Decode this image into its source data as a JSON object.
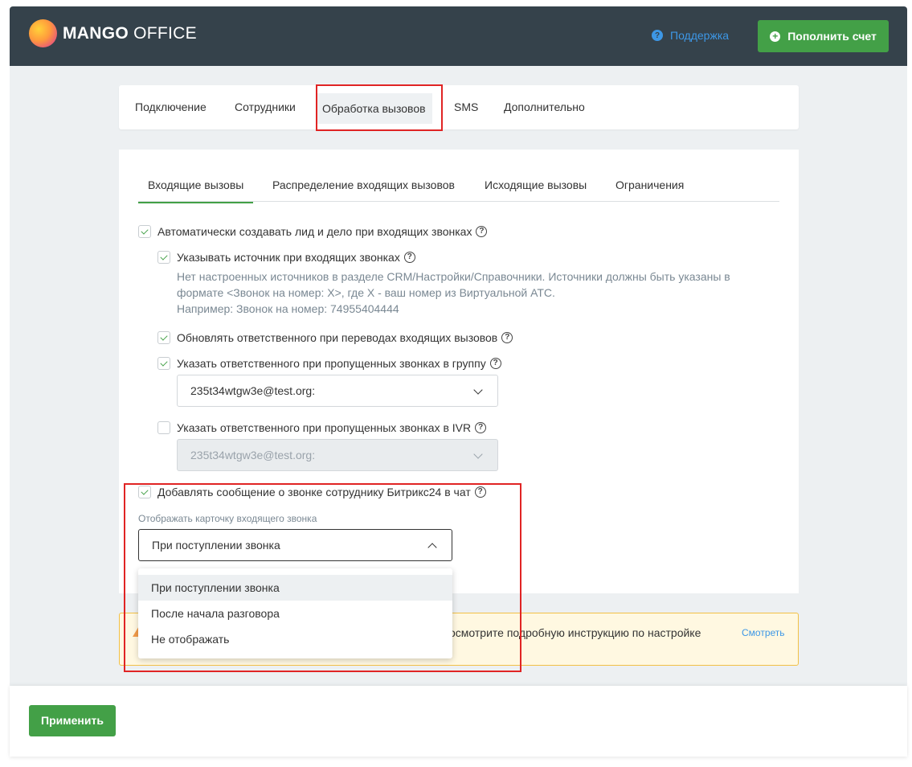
{
  "header": {
    "logo_bold": "MANGO",
    "logo_light": " OFFICE",
    "support_label": "Поддержка",
    "topup_label": "Пополнить счет"
  },
  "main_tabs": [
    {
      "label": "Подключение"
    },
    {
      "label": "Сотрудники"
    },
    {
      "label": "Обработка вызовов"
    },
    {
      "label": "SMS"
    },
    {
      "label": "Дополнительно"
    }
  ],
  "sub_tabs": [
    {
      "label": "Входящие вызовы"
    },
    {
      "label": "Распределение входящих вызовов"
    },
    {
      "label": "Исходящие вызовы"
    },
    {
      "label": "Ограничения"
    }
  ],
  "settings": {
    "auto_lead": {
      "label": "Автоматически создавать лид и дело при входящих звонках",
      "checked": true
    },
    "source": {
      "label": "Указывать источник при входящих звонках",
      "checked": true
    },
    "hint_line1": "Нет настроенных источников в разделе CRM/Настройки/Справочники. Источники должны быть указаны в",
    "hint_line2": "формате <Звонок на номер: X>, где X - ваш номер из Виртуальной АТС.",
    "hint_line3": "Например: Звонок на номер: 74955404444",
    "update_responsible": {
      "label": "Обновлять ответственного при переводах входящих вызовов",
      "checked": true
    },
    "missed_group": {
      "label": "Указать ответственного при пропущенных звонках в группу",
      "checked": true
    },
    "missed_group_value": "235t34wtgw3e@test.org:",
    "missed_ivr": {
      "label": "Указать ответственного при пропущенных звонках в IVR",
      "checked": false
    },
    "missed_ivr_value": "235t34wtgw3e@test.org:",
    "chat_message": {
      "label": "Добавлять сообщение о звонке сотруднику Битрикс24 в чат",
      "checked": true
    },
    "card_label": "Отображать карточку входящего звонка",
    "card_value": "При поступлении звонка"
  },
  "dropdown_options": [
    {
      "label": "При поступлении звонка",
      "selected": true
    },
    {
      "label": "После начала разговора",
      "selected": false
    },
    {
      "label": "Не отображать",
      "selected": false
    }
  ],
  "warning": {
    "text": "осмотрите подробную инструкцию по настройке",
    "link": "Смотреть"
  },
  "footer": {
    "apply_label": "Применить"
  },
  "colors": {
    "header_bg": "#35424b",
    "accent_green": "#43a047",
    "link_blue": "#3d97e6",
    "highlight_red": "#e02424"
  }
}
